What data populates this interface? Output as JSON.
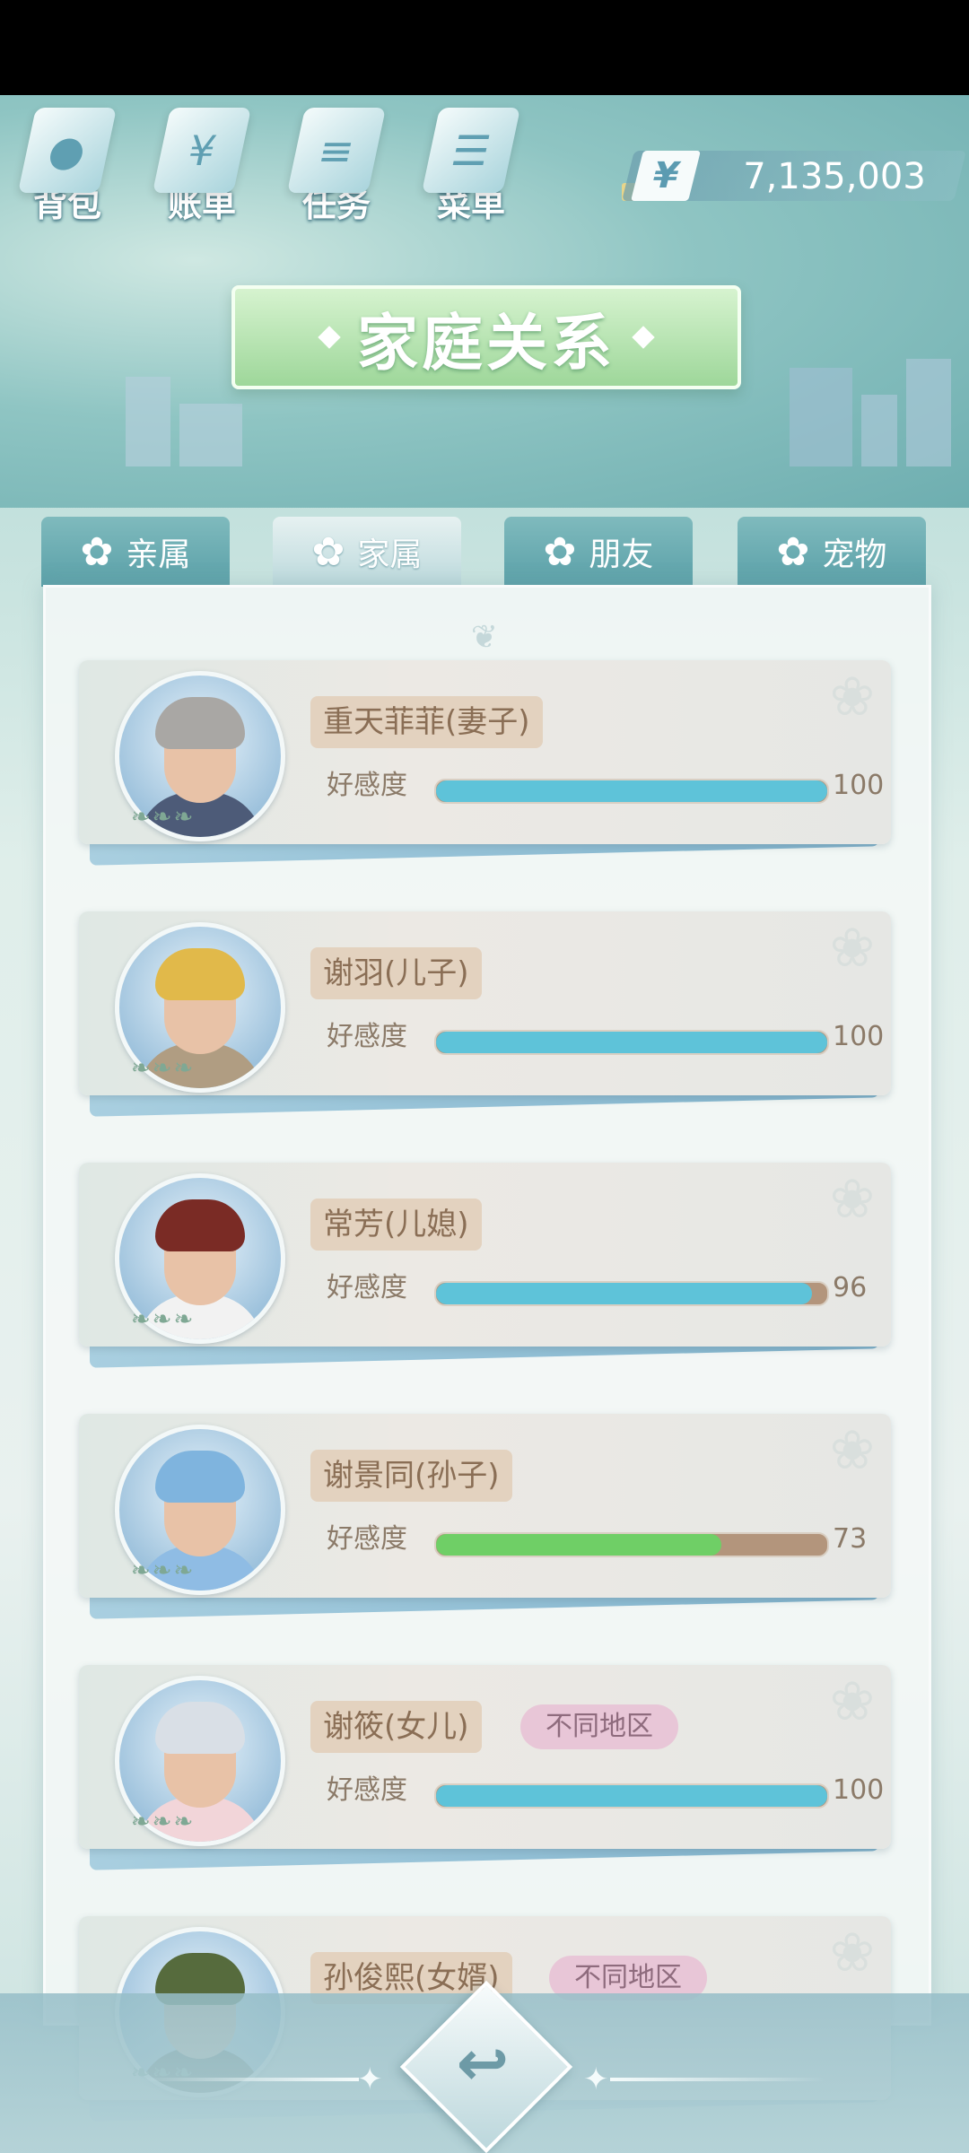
{
  "nav": [
    {
      "label": "背包",
      "icon": "bag-icon"
    },
    {
      "label": "账单",
      "icon": "bill-icon"
    },
    {
      "label": "任务",
      "icon": "task-icon"
    },
    {
      "label": "菜单",
      "icon": "menu-icon"
    }
  ],
  "money": {
    "symbol": "¥",
    "value": "7,135,003"
  },
  "title": "家庭关系",
  "tabs": [
    {
      "label": "亲属",
      "active": false
    },
    {
      "label": "家属",
      "active": true
    },
    {
      "label": "朋友",
      "active": false
    },
    {
      "label": "宠物",
      "active": false
    }
  ],
  "favor_label": "好感度",
  "members": [
    {
      "name": "重天菲菲(妻子)",
      "favor": 100,
      "favor_text": "100",
      "bar_color": "#5ec3d9",
      "region": ""
    },
    {
      "name": "谢羽(儿子)",
      "favor": 100,
      "favor_text": "100",
      "bar_color": "#5ec3d9",
      "region": ""
    },
    {
      "name": "常芳(儿媳)",
      "favor": 96,
      "favor_text": "96",
      "bar_color": "#5ec3d9",
      "region": ""
    },
    {
      "name": "谢景同(孙子)",
      "favor": 73,
      "favor_text": "73",
      "bar_color": "#6fcf66",
      "region": ""
    },
    {
      "name": "谢筱(女儿)",
      "favor": 100,
      "favor_text": "100",
      "bar_color": "#5ec3d9",
      "region": "不同地区"
    },
    {
      "name": "孙俊熙(女婿)",
      "favor": null,
      "favor_text": "",
      "bar_color": "#5ec3d9",
      "region": "不同地区"
    }
  ]
}
